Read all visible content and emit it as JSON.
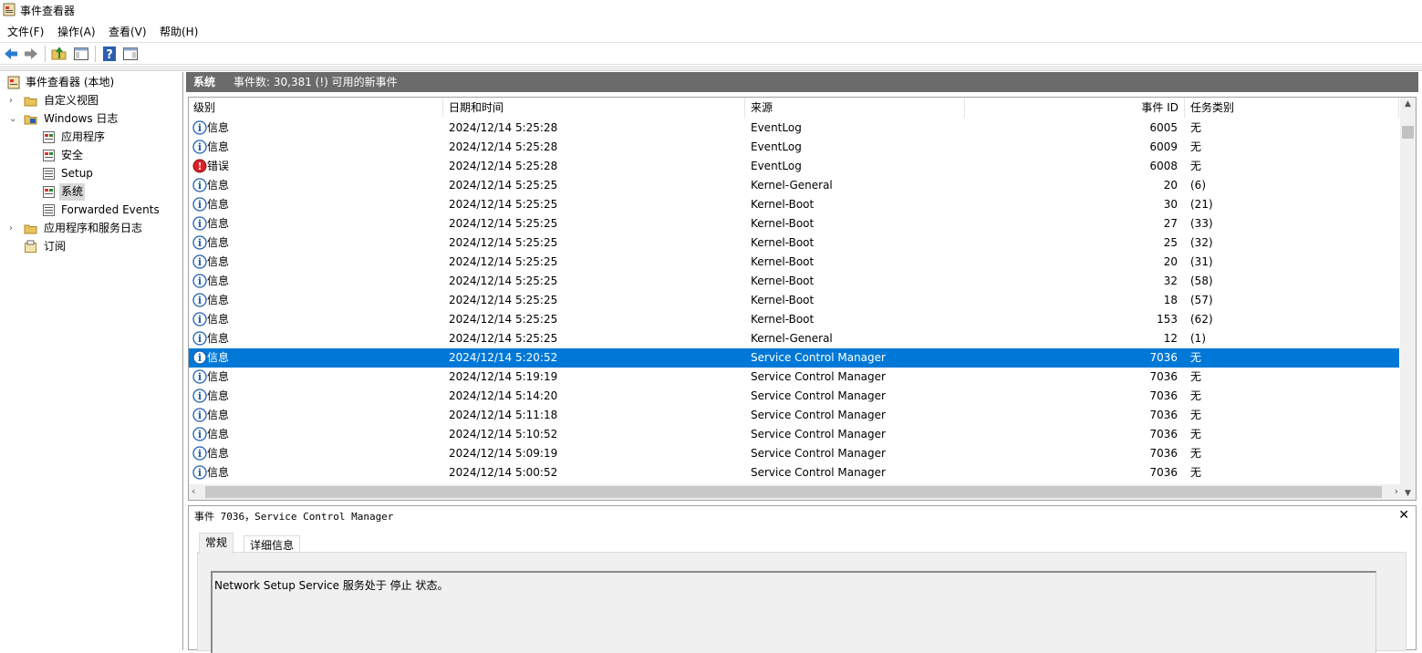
{
  "window": {
    "title": "事件查看器"
  },
  "menu": [
    "文件(F)",
    "操作(A)",
    "查看(V)",
    "帮助(H)"
  ],
  "toolbar_icons": [
    "back-arrow-icon",
    "forward-arrow-icon",
    "folder-up-icon",
    "show-hide-tree-icon",
    "help-icon",
    "show-hide-action-pane-icon"
  ],
  "tree": {
    "root": "事件查看器 (本地)",
    "custom_views": "自定义视图",
    "windows_logs": "Windows 日志",
    "application": "应用程序",
    "security": "安全",
    "setup": "Setup",
    "system": "系统",
    "forwarded": "Forwarded Events",
    "app_service_logs": "应用程序和服务日志",
    "subscriptions": "订阅"
  },
  "pane_header": {
    "name": "系统",
    "count": "事件数: 30,381 (!) 可用的新事件"
  },
  "columns": {
    "level": "级别",
    "datetime": "日期和时间",
    "source": "来源",
    "event_id": "事件 ID",
    "task": "任务类别"
  },
  "events": [
    {
      "type": "info",
      "level": "信息",
      "datetime": "2024/12/14 5:25:28",
      "source": "EventLog",
      "event_id": "6005",
      "task": "无"
    },
    {
      "type": "info",
      "level": "信息",
      "datetime": "2024/12/14 5:25:28",
      "source": "EventLog",
      "event_id": "6009",
      "task": "无"
    },
    {
      "type": "error",
      "level": "错误",
      "datetime": "2024/12/14 5:25:28",
      "source": "EventLog",
      "event_id": "6008",
      "task": "无"
    },
    {
      "type": "info",
      "level": "信息",
      "datetime": "2024/12/14 5:25:25",
      "source": "Kernel-General",
      "event_id": "20",
      "task": "(6)"
    },
    {
      "type": "info",
      "level": "信息",
      "datetime": "2024/12/14 5:25:25",
      "source": "Kernel-Boot",
      "event_id": "30",
      "task": "(21)"
    },
    {
      "type": "info",
      "level": "信息",
      "datetime": "2024/12/14 5:25:25",
      "source": "Kernel-Boot",
      "event_id": "27",
      "task": "(33)"
    },
    {
      "type": "info",
      "level": "信息",
      "datetime": "2024/12/14 5:25:25",
      "source": "Kernel-Boot",
      "event_id": "25",
      "task": "(32)"
    },
    {
      "type": "info",
      "level": "信息",
      "datetime": "2024/12/14 5:25:25",
      "source": "Kernel-Boot",
      "event_id": "20",
      "task": "(31)"
    },
    {
      "type": "info",
      "level": "信息",
      "datetime": "2024/12/14 5:25:25",
      "source": "Kernel-Boot",
      "event_id": "32",
      "task": "(58)"
    },
    {
      "type": "info",
      "level": "信息",
      "datetime": "2024/12/14 5:25:25",
      "source": "Kernel-Boot",
      "event_id": "18",
      "task": "(57)"
    },
    {
      "type": "info",
      "level": "信息",
      "datetime": "2024/12/14 5:25:25",
      "source": "Kernel-Boot",
      "event_id": "153",
      "task": "(62)"
    },
    {
      "type": "info",
      "level": "信息",
      "datetime": "2024/12/14 5:25:25",
      "source": "Kernel-General",
      "event_id": "12",
      "task": "(1)"
    },
    {
      "type": "info",
      "level": "信息",
      "datetime": "2024/12/14 5:20:52",
      "source": "Service Control Manager",
      "event_id": "7036",
      "task": "无"
    },
    {
      "type": "info",
      "level": "信息",
      "datetime": "2024/12/14 5:19:19",
      "source": "Service Control Manager",
      "event_id": "7036",
      "task": "无"
    },
    {
      "type": "info",
      "level": "信息",
      "datetime": "2024/12/14 5:14:20",
      "source": "Service Control Manager",
      "event_id": "7036",
      "task": "无"
    },
    {
      "type": "info",
      "level": "信息",
      "datetime": "2024/12/14 5:11:18",
      "source": "Service Control Manager",
      "event_id": "7036",
      "task": "无"
    },
    {
      "type": "info",
      "level": "信息",
      "datetime": "2024/12/14 5:10:52",
      "source": "Service Control Manager",
      "event_id": "7036",
      "task": "无"
    },
    {
      "type": "info",
      "level": "信息",
      "datetime": "2024/12/14 5:09:19",
      "source": "Service Control Manager",
      "event_id": "7036",
      "task": "无"
    },
    {
      "type": "info",
      "level": "信息",
      "datetime": "2024/12/14 5:00:52",
      "source": "Service Control Manager",
      "event_id": "7036",
      "task": "无"
    }
  ],
  "selected_event": 12,
  "detail": {
    "title": "事件 7036，Service Control Manager",
    "tab_general": "常规",
    "tab_details": "详细信息",
    "message": "Network Setup Service 服务处于 停止 状态。"
  },
  "colors": {
    "selection": "#0078d7",
    "header_bar": "#6b6b6b",
    "error": "#d9222a",
    "info": "#1f5fae"
  }
}
